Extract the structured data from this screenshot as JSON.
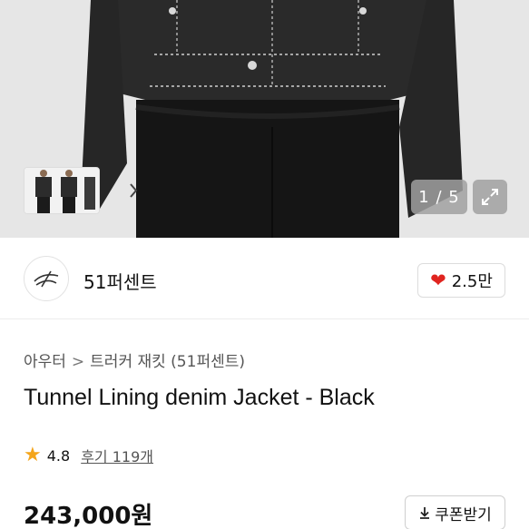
{
  "gallery": {
    "counter": "1 / 5",
    "thumb_next_icon": "chevron-right-icon",
    "expand_icon": "expand-icon"
  },
  "brand": {
    "name": "51퍼센트",
    "likes": "2.5만",
    "heart_color": "#e0241f"
  },
  "product": {
    "breadcrumb": [
      "아우터",
      "트러커 재킷 (51퍼센트)"
    ],
    "breadcrumb_separator": ">",
    "title": "Tunnel Lining denim Jacket - Black",
    "rating": "4.8",
    "review_label": "후기 119개",
    "star_color": "#f4a51c",
    "price": "243,000원",
    "coupon_label": "쿠폰받기"
  }
}
